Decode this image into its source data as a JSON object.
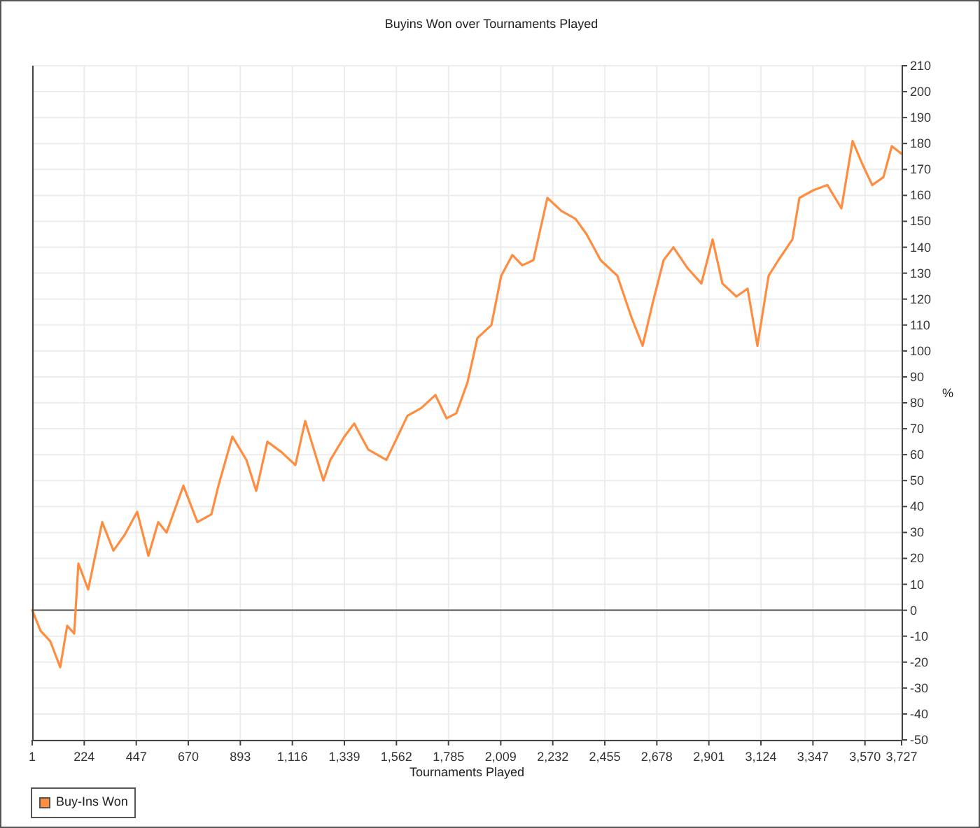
{
  "chart": {
    "chart_data": {
      "type": "line",
      "title": "Buyins Won over Tournaments Played",
      "xlabel": "Tournaments Played",
      "ylabel": "%",
      "x": [
        1,
        37,
        79,
        121,
        151,
        181,
        199,
        241,
        301,
        349,
        397,
        451,
        499,
        541,
        577,
        649,
        709,
        769,
        799,
        859,
        919,
        961,
        1009,
        1069,
        1129,
        1171,
        1249,
        1279,
        1339,
        1381,
        1441,
        1519,
        1567,
        1609,
        1669,
        1729,
        1777,
        1819,
        1867,
        1909,
        1969,
        2011,
        2059,
        2101,
        2149,
        2209,
        2269,
        2329,
        2377,
        2437,
        2509,
        2569,
        2617,
        2659,
        2707,
        2749,
        2809,
        2869,
        2917,
        2959,
        3019,
        3067,
        3109,
        3157,
        3199,
        3259,
        3289,
        3349,
        3409,
        3469,
        3517,
        3559,
        3601,
        3649,
        3685,
        3727
      ],
      "series": [
        {
          "name": "Buy-Ins Won",
          "color": "#ff8c3f",
          "values": [
            0,
            -8,
            -12,
            -22,
            -6,
            -9,
            18,
            8,
            34,
            23,
            29,
            38,
            21,
            34,
            30,
            48,
            34,
            37,
            48,
            67,
            58,
            46,
            65,
            61,
            56,
            73,
            50,
            58,
            67,
            72,
            62,
            58,
            67,
            75,
            78,
            83,
            74,
            76,
            88,
            105,
            110,
            129,
            137,
            133,
            135,
            159,
            154,
            151,
            145,
            135,
            129,
            113,
            102,
            118,
            135,
            140,
            132,
            126,
            143,
            126,
            121,
            124,
            102,
            129,
            135,
            143,
            159,
            162,
            164,
            155,
            181,
            172,
            164,
            167,
            179,
            176
          ]
        }
      ],
      "xlim": [
        1,
        3727
      ],
      "ylim": [
        -50,
        210
      ],
      "xticks": [
        1,
        224,
        447,
        670,
        893,
        {
          "value": 1116,
          "label": "1,116"
        },
        {
          "value": 1339,
          "label": "1,339"
        },
        {
          "value": 1562,
          "label": "1,562"
        },
        {
          "value": 1785,
          "label": "1,785"
        },
        {
          "value": 2009,
          "label": "2,009"
        },
        {
          "value": 2232,
          "label": "2,232"
        },
        {
          "value": 2455,
          "label": "2,455"
        },
        {
          "value": 2678,
          "label": "2,678"
        },
        {
          "value": 2901,
          "label": "2,901"
        },
        {
          "value": 3124,
          "label": "3,124"
        },
        {
          "value": 3347,
          "label": "3,347"
        },
        {
          "value": 3570,
          "label": "3,570"
        },
        {
          "value": 3727,
          "label": "3,727"
        }
      ],
      "yticks": [
        -50,
        -40,
        -30,
        -20,
        -10,
        0,
        10,
        20,
        30,
        40,
        50,
        60,
        70,
        80,
        90,
        100,
        110,
        120,
        130,
        140,
        150,
        160,
        170,
        180,
        190,
        200,
        210
      ],
      "grid": true,
      "legend": true
    }
  }
}
